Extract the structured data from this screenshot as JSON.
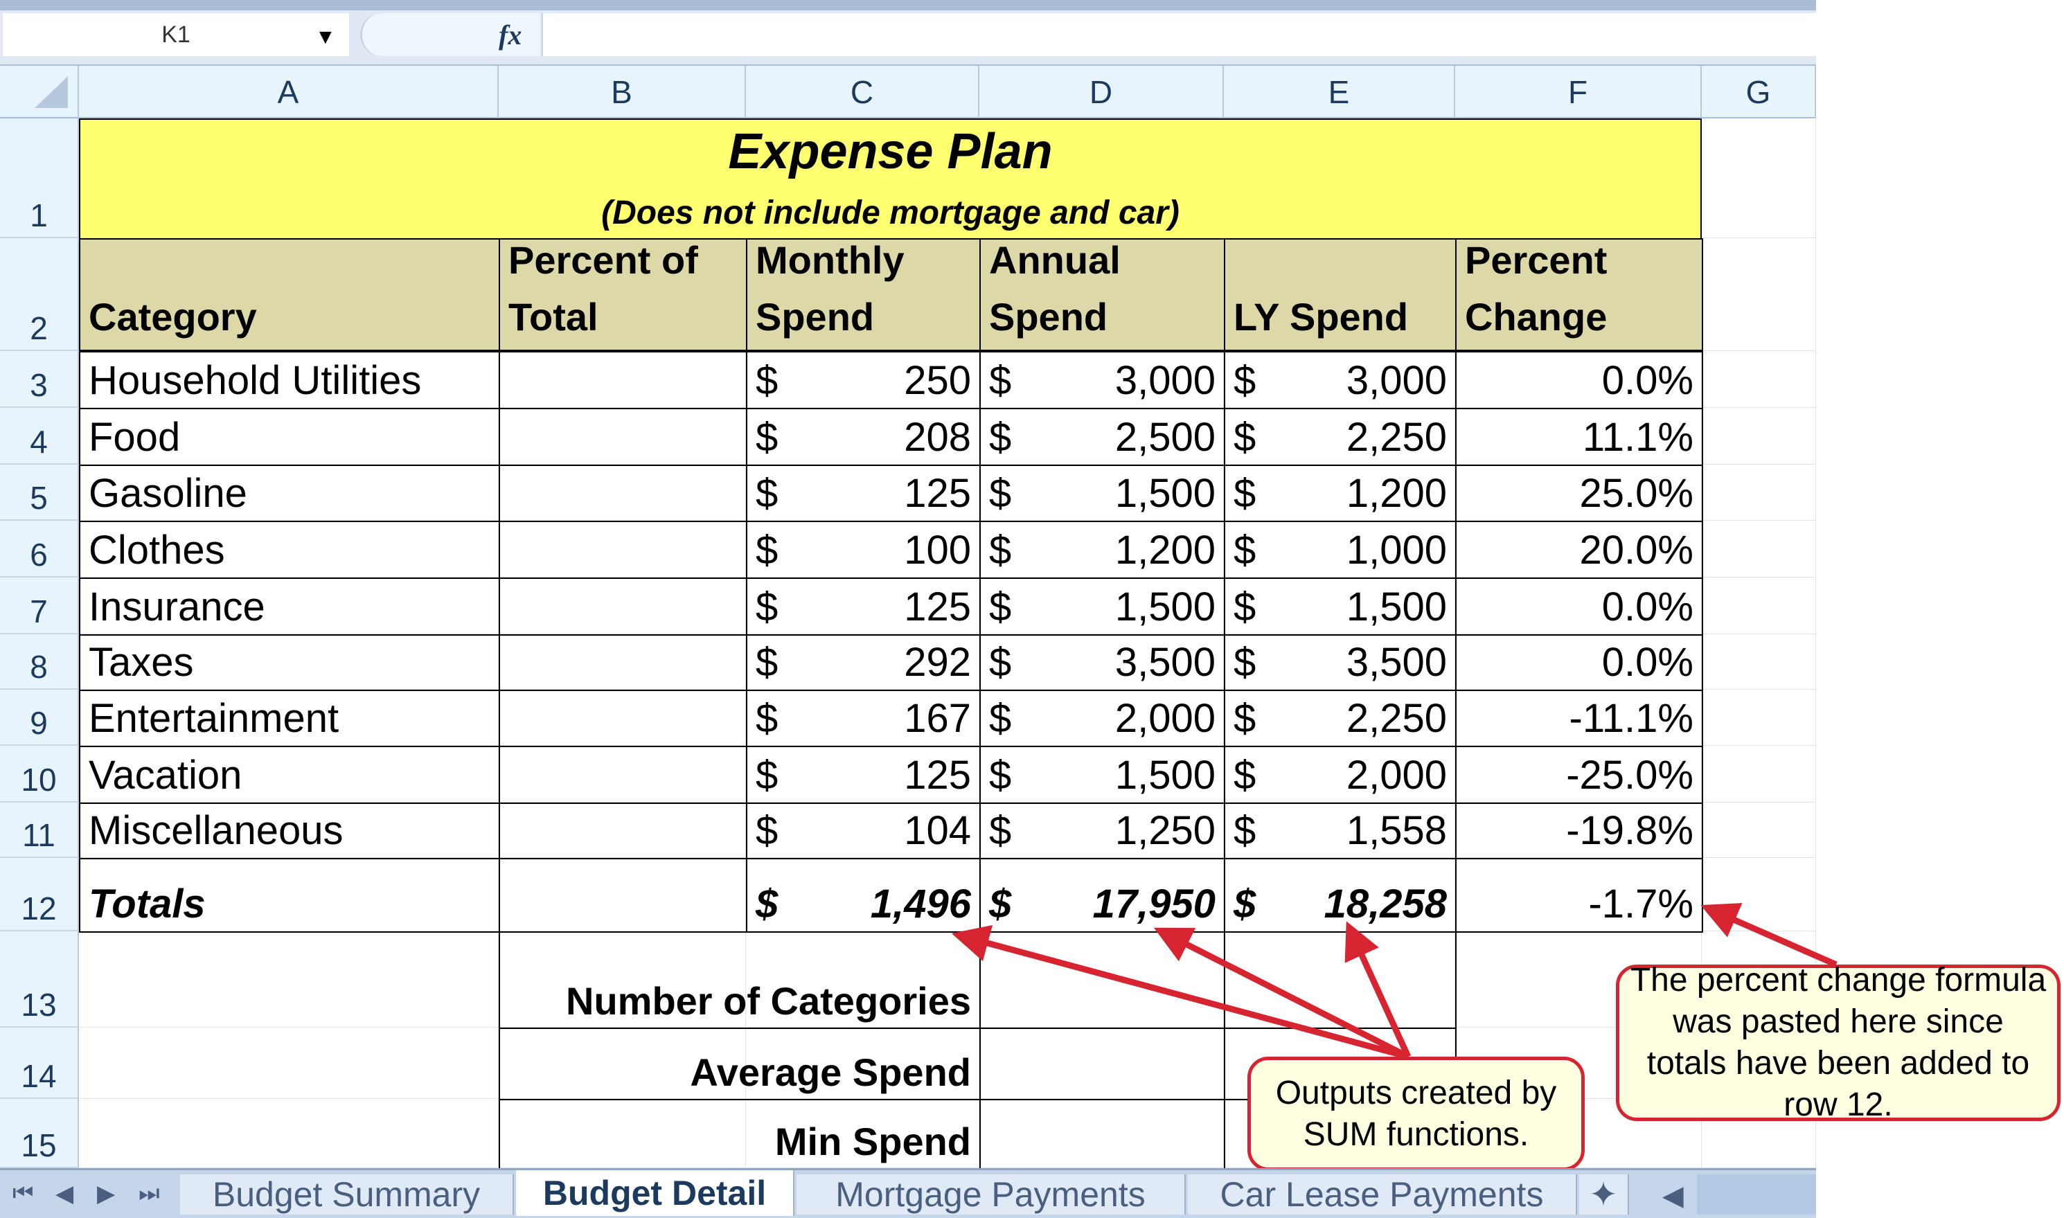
{
  "formula_bar": {
    "name_box": "K1",
    "fx_label": "fx",
    "formula": ""
  },
  "columns": [
    "A",
    "B",
    "C",
    "D",
    "E",
    "F",
    "G"
  ],
  "sheet": {
    "title": "Expense Plan",
    "subtitle": "(Does not include mortgage and car)",
    "headers": {
      "row": "2",
      "a": "Category",
      "b": "Percent of Total",
      "c": "Monthly Spend",
      "d": "Annual Spend",
      "e": "LY Spend",
      "f": "Percent Change"
    },
    "rows": [
      {
        "row": "3",
        "category": "Household Utilities",
        "monthly": "250",
        "annual": "3,000",
        "ly": "3,000",
        "change": "0.0%"
      },
      {
        "row": "4",
        "category": "Food",
        "monthly": "208",
        "annual": "2,500",
        "ly": "2,250",
        "change": "11.1%"
      },
      {
        "row": "5",
        "category": "Gasoline",
        "monthly": "125",
        "annual": "1,500",
        "ly": "1,200",
        "change": "25.0%"
      },
      {
        "row": "6",
        "category": "Clothes",
        "monthly": "100",
        "annual": "1,200",
        "ly": "1,000",
        "change": "20.0%"
      },
      {
        "row": "7",
        "category": "Insurance",
        "monthly": "125",
        "annual": "1,500",
        "ly": "1,500",
        "change": "0.0%"
      },
      {
        "row": "8",
        "category": "Taxes",
        "monthly": "292",
        "annual": "3,500",
        "ly": "3,500",
        "change": "0.0%"
      },
      {
        "row": "9",
        "category": "Entertainment",
        "monthly": "167",
        "annual": "2,000",
        "ly": "2,250",
        "change": "-11.1%"
      },
      {
        "row": "10",
        "category": "Vacation",
        "monthly": "125",
        "annual": "1,500",
        "ly": "2,000",
        "change": "-25.0%"
      },
      {
        "row": "11",
        "category": "Miscellaneous",
        "monthly": "104",
        "annual": "1,250",
        "ly": "1,558",
        "change": "-19.8%"
      }
    ],
    "currency": "$",
    "totals": {
      "row": "12",
      "label": "Totals",
      "monthly": "1,496",
      "annual": "17,950",
      "ly": "18,258",
      "change": "-1.7%"
    },
    "stats": [
      {
        "row": "13",
        "label": "Number of Categories"
      },
      {
        "row": "14",
        "label": "Average Spend"
      },
      {
        "row": "15",
        "label": "Min Spend"
      }
    ],
    "row1": "1"
  },
  "tabs": [
    {
      "label": "Budget Summary",
      "active": false
    },
    {
      "label": "Budget Detail",
      "active": true
    },
    {
      "label": "Mortgage Payments",
      "active": false
    },
    {
      "label": "Car Lease Payments",
      "active": false
    }
  ],
  "callouts": {
    "sum": "Outputs created by SUM functions.",
    "percent": "The percent change formula was pasted here since totals have been added to row 12."
  },
  "colors": {
    "title_fill": "#ffff70",
    "header_fill": "#ddd8a8",
    "callout_border": "#d62430",
    "callout_fill": "#ffffe2"
  }
}
